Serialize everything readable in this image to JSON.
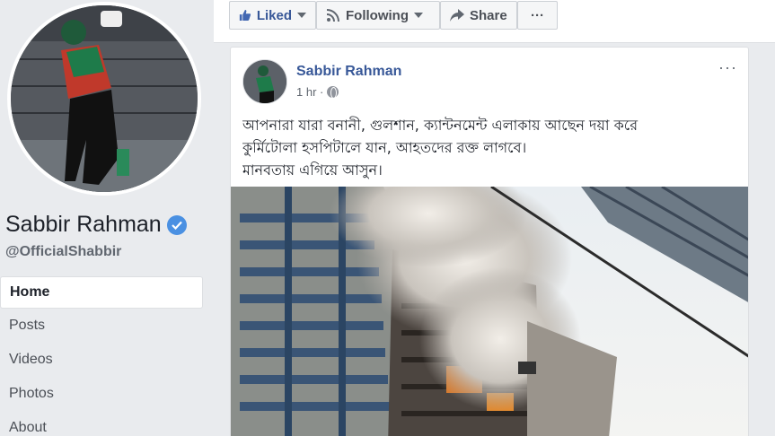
{
  "profile": {
    "name": "Sabbir Rahman",
    "handle": "@OfficialShabbir",
    "verified": true,
    "verified_color": "#4a90e2"
  },
  "nav": {
    "items": [
      {
        "label": "Home",
        "active": true
      },
      {
        "label": "Posts",
        "active": false
      },
      {
        "label": "Videos",
        "active": false
      },
      {
        "label": "Photos",
        "active": false
      },
      {
        "label": "About",
        "active": false
      }
    ]
  },
  "topbar": {
    "liked_label": "Liked",
    "following_label": "Following",
    "share_label": "Share",
    "more_label": "···"
  },
  "post": {
    "author": "Sabbir Rahman",
    "time": "1 hr ·",
    "menu": "···",
    "lines": [
      "আপনারা যারা বনানী, গুলশান, ক্যান্টনমেন্ট এলাকায় আছেন দয়া করে",
      "কুর্মিটোলা হসপিটালে যান, আহতদের রক্ত লাগবে।",
      "মানবতায় এগিয়ে আসুন।"
    ]
  },
  "colors": {
    "link_blue": "#385898",
    "background": "#e9ebee",
    "text": "#1d2129"
  }
}
